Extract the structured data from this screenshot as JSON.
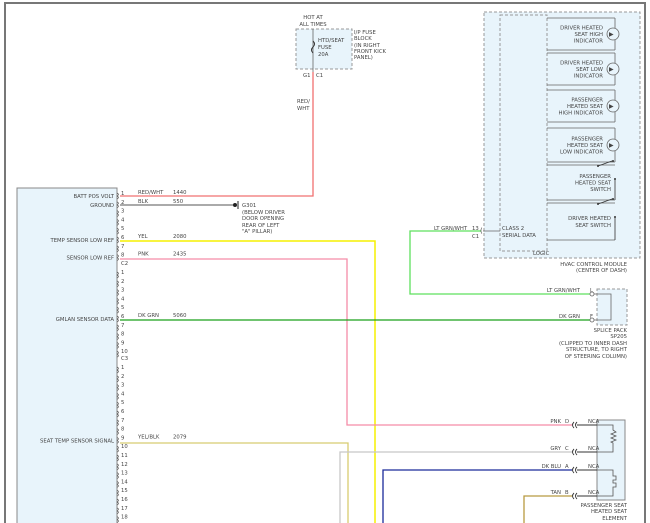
{
  "fuse": {
    "hot": [
      "HOT AT",
      "ALL TIMES"
    ],
    "name": [
      "HTD/SEAT",
      "FUSE",
      "20A"
    ],
    "location": [
      "I/P FUSE",
      "BLOCK",
      "(IN RIGHT",
      "FRONT KICK",
      "PANEL)"
    ],
    "pin": "G1",
    "connector": "C1"
  },
  "red_wire": [
    "RED/",
    "WHT"
  ],
  "module": {
    "c1": [
      {
        "pin": "1",
        "label": "BATT POS VOLT",
        "color": "RED/WHT",
        "circuit": "1440"
      },
      {
        "pin": "2",
        "label": "GROUND",
        "color": "BLK",
        "circuit": "550"
      },
      {
        "pin": "3"
      },
      {
        "pin": "4"
      },
      {
        "pin": "5"
      },
      {
        "pin": "6",
        "label": "TEMP SENSOR LOW REF",
        "color": "YEL",
        "circuit": "2080"
      },
      {
        "pin": "7"
      },
      {
        "pin": "8",
        "label": "SENSOR LOW REF",
        "color": "PNK",
        "circuit": "2435"
      }
    ],
    "c2_label": "C2",
    "c2": [
      {
        "pin": "1"
      },
      {
        "pin": "2"
      },
      {
        "pin": "3"
      },
      {
        "pin": "4"
      },
      {
        "pin": "5"
      },
      {
        "pin": "6",
        "label": "GMLAN SENSOR DATA",
        "color": "DK GRN",
        "circuit": "5060"
      },
      {
        "pin": "7"
      },
      {
        "pin": "8"
      },
      {
        "pin": "9"
      },
      {
        "pin": "10"
      }
    ],
    "c3_label": "C3",
    "c3": [
      {
        "pin": "1"
      },
      {
        "pin": "2"
      },
      {
        "pin": "3"
      },
      {
        "pin": "4"
      },
      {
        "pin": "5"
      },
      {
        "pin": "6"
      },
      {
        "pin": "7"
      },
      {
        "pin": "8"
      },
      {
        "pin": "9",
        "label": "SEAT TEMP SENSOR SIGNAL",
        "color": "YEL/BLK",
        "circuit": "2079"
      },
      {
        "pin": "10"
      },
      {
        "pin": "11"
      },
      {
        "pin": "12"
      },
      {
        "pin": "13"
      },
      {
        "pin": "14"
      },
      {
        "pin": "15"
      },
      {
        "pin": "16"
      },
      {
        "pin": "17"
      },
      {
        "pin": "18"
      }
    ]
  },
  "ground": {
    "id": "G301",
    "location": [
      "(BELOW DRIVER",
      "DOOR OPENING",
      "REAR OF LEFT",
      "\"A\" PILLAR)"
    ]
  },
  "hvac": {
    "items": [
      [
        "DRIVER HEATED",
        "SEAT HIGH",
        "INDICATOR"
      ],
      [
        "DRIVER HEATED",
        "SEAT LOW",
        "INDICATOR"
      ],
      [
        "PASSENGER",
        "HEATED SEAT",
        "HIGH INDICATOR"
      ],
      [
        "PASSENGER",
        "HEATED SEAT",
        "LOW INDICATOR"
      ],
      [
        "PASSENGER",
        "HEATED SEAT",
        "SWITCH"
      ],
      [
        "DRIVER HEATED",
        "SEAT SWITCH"
      ]
    ],
    "serial": [
      "CLASS 2",
      "SERIAL DATA"
    ],
    "logic": "LOGIC",
    "name": [
      "HVAC CONTROL MODULE",
      "(CENTER OF DASH)"
    ],
    "pin": "13",
    "connector": "C1",
    "wire": "LT GRN/WHT"
  },
  "splice": {
    "pins": [
      {
        "pin": "L",
        "wire": "LT GRN/WHT"
      },
      {
        "pin": "F",
        "wire": "DK GRN"
      }
    ],
    "name": [
      "SPLICE PACK",
      "SP205",
      "(CLIPPED TO INNER DASH",
      "STRUCTURE, TO RIGHT",
      "OF STEERING COLUMN)"
    ]
  },
  "seat_element": {
    "pins": [
      {
        "pin": "D",
        "wire": "PNK",
        "conn": "NCA"
      },
      {
        "pin": "C",
        "wire": "GRY",
        "conn": "NCA"
      },
      {
        "pin": "A",
        "wire": "DK BLU",
        "conn": "NCA"
      },
      {
        "pin": "B",
        "wire": "TAN",
        "conn": "NCA"
      }
    ],
    "name": [
      "PASSENGER SEAT",
      "HEATED SEAT",
      "ELEMENT"
    ]
  },
  "colors": {
    "red": "#f07070",
    "black": "#555555",
    "yellow": "#f5f000",
    "pink": "#f58ca8",
    "dk_green": "#1aa01a",
    "lt_green": "#5ee05e",
    "yel_blk": "#d8cc70",
    "gray": "#c8c8c8",
    "dk_blue": "#1a2a9a",
    "tan": "#b89a40"
  }
}
